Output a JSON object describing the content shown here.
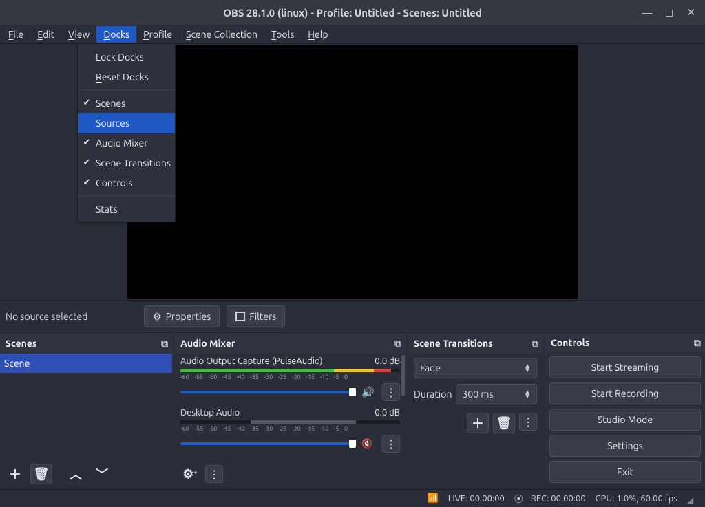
{
  "window": {
    "title": "OBS 28.1.0 (linux) - Profile: Untitled - Scenes: Untitled"
  },
  "menubar": {
    "file": "File",
    "edit": "Edit",
    "view": "View",
    "docks": "Docks",
    "profile": "Profile",
    "scene_collection": "Scene Collection",
    "tools": "Tools",
    "help": "Help"
  },
  "docks_menu": {
    "lock_docks": "Lock Docks",
    "reset_docks": "Reset Docks",
    "scenes": "Scenes",
    "sources": "Sources",
    "audio_mixer": "Audio Mixer",
    "scene_transitions": "Scene Transitions",
    "controls": "Controls",
    "stats": "Stats"
  },
  "canvas_toolbar": {
    "no_source": "No source selected",
    "properties": "Properties",
    "filters": "Filters"
  },
  "panels": {
    "scenes": {
      "title": "Scenes",
      "items": [
        "Scene"
      ]
    },
    "mixer": {
      "title": "Audio Mixer",
      "tracks": [
        {
          "name": "Audio Output Capture (PulseAudio)",
          "db": "0.0 dB",
          "muted": false
        },
        {
          "name": "Desktop Audio",
          "db": "0.0 dB",
          "muted": true
        }
      ],
      "scale": [
        "-60",
        "-55",
        "-50",
        "-45",
        "-40",
        "-35",
        "-30",
        "-25",
        "-20",
        "-15",
        "-10",
        "-5",
        "0"
      ]
    },
    "transitions": {
      "title": "Scene Transitions",
      "type": "Fade",
      "duration_label": "Duration",
      "duration_value": "300 ms"
    },
    "controls": {
      "title": "Controls",
      "start_streaming": "Start Streaming",
      "start_recording": "Start Recording",
      "studio_mode": "Studio Mode",
      "settings": "Settings",
      "exit": "Exit"
    }
  },
  "statusbar": {
    "live": "LIVE: 00:00:00",
    "rec": "REC: 00:00:00",
    "cpu": "CPU: 1.0%, 60.00 fps"
  }
}
